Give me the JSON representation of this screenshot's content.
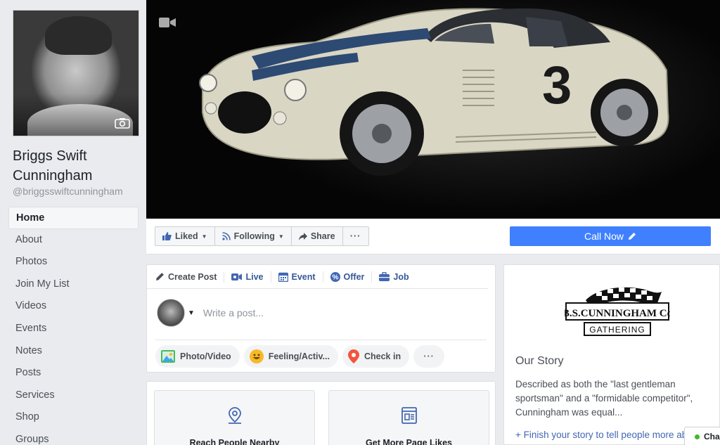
{
  "page": {
    "name": "Briggs Swift Cunningham",
    "handle": "@briggsswiftcunningham"
  },
  "nav": [
    {
      "label": "Home",
      "active": true
    },
    {
      "label": "About"
    },
    {
      "label": "Photos"
    },
    {
      "label": "Join My List"
    },
    {
      "label": "Videos"
    },
    {
      "label": "Events"
    },
    {
      "label": "Notes"
    },
    {
      "label": "Posts"
    },
    {
      "label": "Services"
    },
    {
      "label": "Shop"
    },
    {
      "label": "Groups"
    }
  ],
  "cover": {
    "car_number": "3"
  },
  "actions": {
    "liked": "Liked",
    "following": "Following",
    "share": "Share",
    "more": "···",
    "call_now": "Call Now"
  },
  "composer": {
    "tabs": [
      "Create Post",
      "Live",
      "Event",
      "Offer",
      "Job"
    ],
    "placeholder": "Write a post...",
    "pills": [
      "Photo/Video",
      "Feeling/Activ...",
      "Check in"
    ],
    "more": "···"
  },
  "promo": {
    "cards": [
      "Reach People Nearby",
      "Get More Page Likes"
    ]
  },
  "about": {
    "logo_line1": "B.S.CUNNINGHAM Co",
    "logo_line2": "GATHERING",
    "story_title": "Our Story",
    "story_text": "Described as both the \"last gentleman sportsman\" and a \"formidable competitor\", Cunningham was equal...",
    "finish_link": "+ Finish your story to tell people more about your business."
  },
  "chat": {
    "label": "Cha"
  },
  "colors": {
    "accent": "#4080ff",
    "link": "#365899",
    "background": "#e9ebee"
  }
}
